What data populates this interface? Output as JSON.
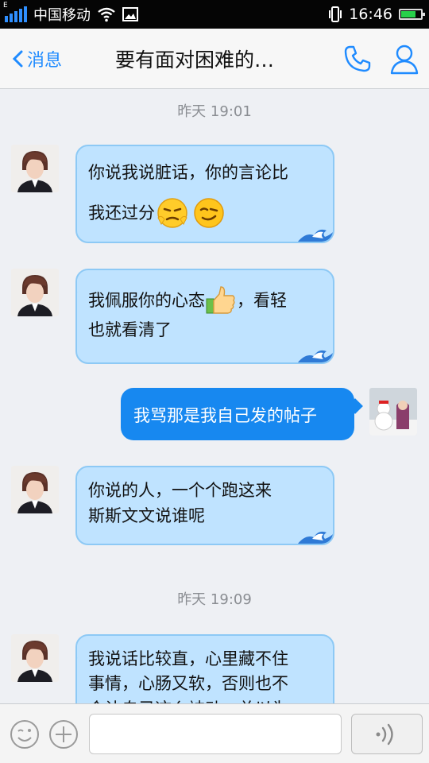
{
  "status_bar": {
    "network_badge": "E",
    "carrier": "中国移动",
    "time": "16:46",
    "battery_level": 0.7,
    "icons": [
      "signal-icon",
      "wifi-icon",
      "image-icon",
      "vibrate-icon",
      "battery-icon"
    ]
  },
  "nav": {
    "back_label": "消息",
    "title": "要有面对困难的…",
    "icons": [
      "back-chevron-icon",
      "phone-icon",
      "person-icon"
    ]
  },
  "messages": [
    {
      "type": "timestamp",
      "text": "昨天 19:01"
    },
    {
      "type": "in",
      "lines": [
        "你说我说脏话，你的言论比",
        "我还过分"
      ],
      "emoji": [
        "smug-face-emoji",
        "wink-face-emoji"
      ]
    },
    {
      "type": "in",
      "lines": [
        "我佩服你的心态",
        "，看轻",
        "也就看清了"
      ],
      "emoji": [
        "thumbs-up-emoji"
      ]
    },
    {
      "type": "out",
      "text": "我骂那是我自己发的帖子"
    },
    {
      "type": "in",
      "lines": [
        "你说的人，一个个跑这来",
        "斯斯文文说谁呢"
      ]
    },
    {
      "type": "timestamp",
      "text": "昨天 19:09"
    },
    {
      "type": "in",
      "lines": [
        "我说话比较直，心里藏不住",
        "事情，心肠又软，否则也不",
        "会让自己这么被动，总以为"
      ]
    }
  ],
  "input_bar": {
    "icons": [
      "emoji-icon",
      "plus-icon",
      "voice-icon"
    ],
    "voice_glyph": "))"
  },
  "colors": {
    "accent": "#1f8bff",
    "bubble_in": "#bfe3ff",
    "bubble_out": "#1788f0",
    "status_bg": "#050505"
  }
}
